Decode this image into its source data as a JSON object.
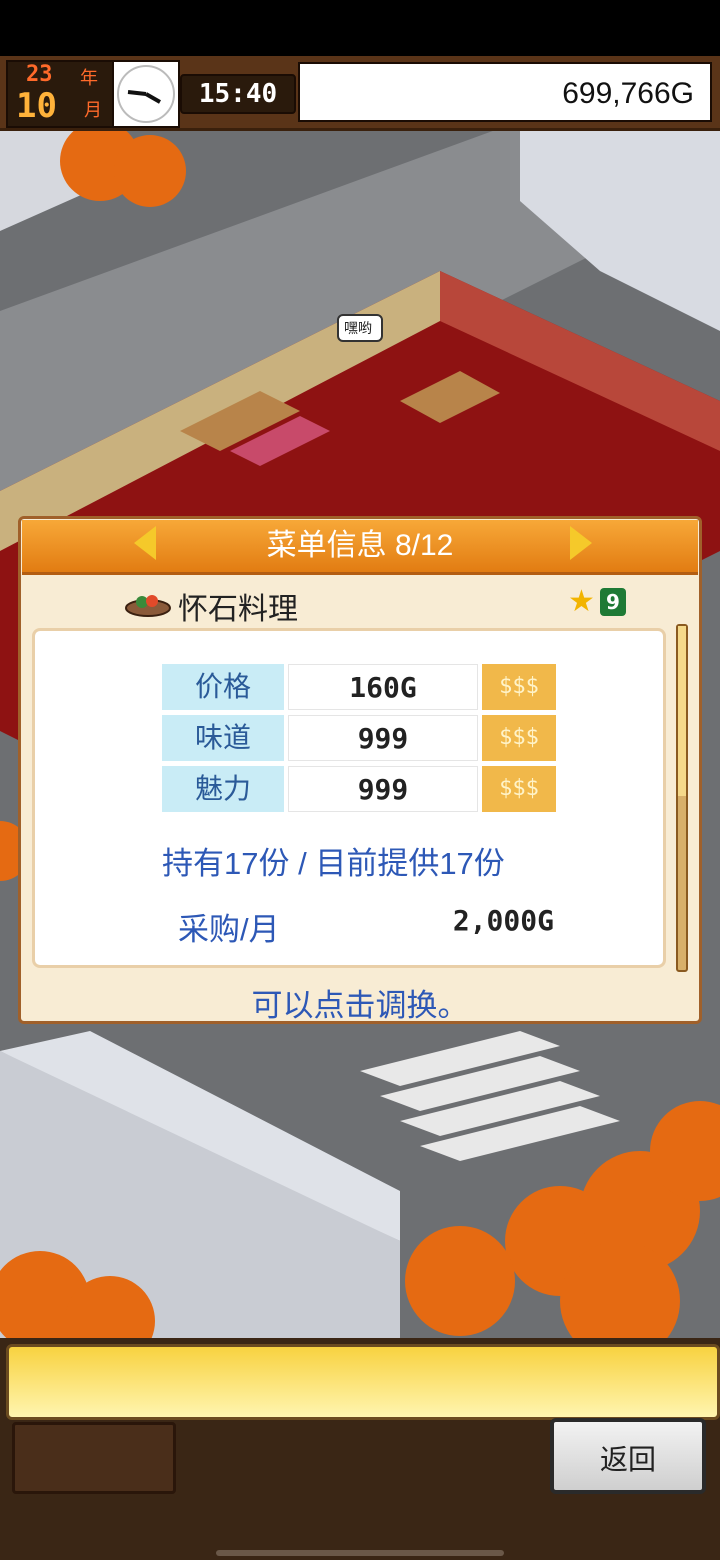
{
  "hud": {
    "year": "23",
    "year_unit": "年",
    "month": "10",
    "month_unit": "月",
    "time": "15:40",
    "money": "699,766G"
  },
  "world": {
    "speech_bubble": "嘿哟"
  },
  "dialog": {
    "title": "菜单信息 8/12",
    "dish_name": "怀石料理",
    "star_count": "9",
    "stats": [
      {
        "label": "价格",
        "value": "160G",
        "rank": "$$$"
      },
      {
        "label": "味道",
        "value": "999",
        "rank": "$$$"
      },
      {
        "label": "魅力",
        "value": "999",
        "rank": "$$$"
      }
    ],
    "stock_text": "持有17份 / 目前提供17份",
    "purchase_label": "采购/月",
    "purchase_value": "2,000G",
    "hint": "可以点击调换。"
  },
  "bottom": {
    "back_label": "返回"
  },
  "colors": {
    "accent_orange": "#f29a2e",
    "text_blue": "#2d58b6",
    "label_bg": "#c9ecf6"
  },
  "icons": [
    "clock-icon",
    "dish-icon",
    "star-icon",
    "arrow-left-icon",
    "arrow-right-icon"
  ]
}
